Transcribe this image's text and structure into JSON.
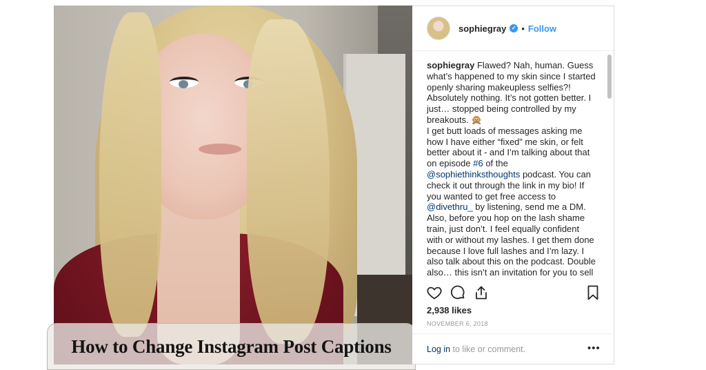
{
  "overlay": {
    "title": "How to Change Instagram Post Captions"
  },
  "post": {
    "username": "sophiegray",
    "verified_icon": "verified-badge-icon",
    "separator": "•",
    "follow_label": "Follow",
    "caption": {
      "username": "sophiegray",
      "p1": " Flawed? Nah, human. Guess what’s happened to my skin since I started openly sharing makeupless selfies?! Absolutely nothing. It’s not gotten better. I just… stopped being controlled by my breakouts. 🙊",
      "p2_a": "I get butt loads of messages asking me how I have either “fixed” me skin, or felt better about it - and I’m talking about that on episode ",
      "p2_hashtag": "#6",
      "p2_b": " of the ",
      "p2_mention": "@sophiethinksthoughts",
      "p2_c": " podcast. You can check it out through the link in my bio! If you wanted to get free access to ",
      "p2_mention2": "@divethru_",
      "p2_d": " by listening, send me a DM.",
      "p3": "Also, before you hop on the lash shame train, just don’t. I feel equally confident with or without my lashes. I get them done because I love full lashes and I’m lazy. I also talk about this on the podcast. Double also… this isn’t an invitation for you to sell me anything, thanks xx"
    },
    "likes": "2,938 likes",
    "date": "NOVEMBER 6, 2018",
    "login_link": "Log in",
    "login_rest": " to like or comment.",
    "more_label": "•••"
  },
  "colors": {
    "accent": "#3897f0",
    "link": "#003569",
    "text": "#262626",
    "muted": "#999999"
  },
  "icons": [
    "heart-icon",
    "comment-icon",
    "share-icon",
    "bookmark-icon",
    "more-options-icon"
  ]
}
